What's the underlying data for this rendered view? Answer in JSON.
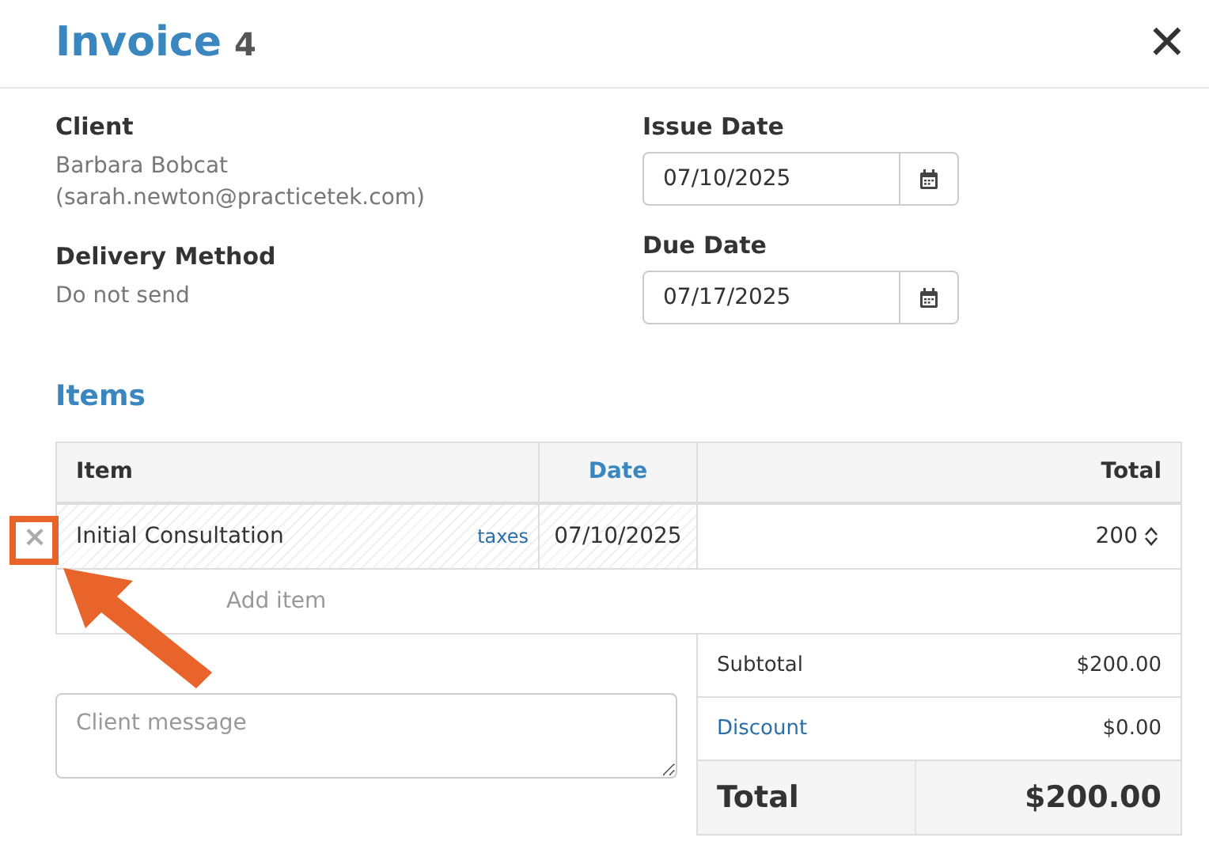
{
  "header": {
    "title": "Invoice",
    "number": "4",
    "close": "✕"
  },
  "client": {
    "label": "Client",
    "name": "Barbara Bobcat",
    "email": "(sarah.newton@practicetek.com)"
  },
  "delivery": {
    "label": "Delivery Method",
    "value": "Do not send"
  },
  "issue_date": {
    "label": "Issue Date",
    "value": "07/10/2025"
  },
  "due_date": {
    "label": "Due Date",
    "value": "07/17/2025"
  },
  "items": {
    "title": "Items",
    "columns": [
      "Item",
      "Date",
      "Total"
    ],
    "rows": [
      {
        "remove": "×",
        "item": "Initial Consultation",
        "taxes": "taxes",
        "date": "07/10/2025",
        "total": "200"
      }
    ],
    "add_placeholder": "Add item"
  },
  "message": {
    "placeholder": "Client message"
  },
  "summary": [
    {
      "kind": "plain",
      "label": "Subtotal",
      "value": "$200.00"
    },
    {
      "kind": "link",
      "label": "Discount",
      "value": "$0.00"
    },
    {
      "kind": "total",
      "label": "Total",
      "value": "$200.00"
    }
  ]
}
